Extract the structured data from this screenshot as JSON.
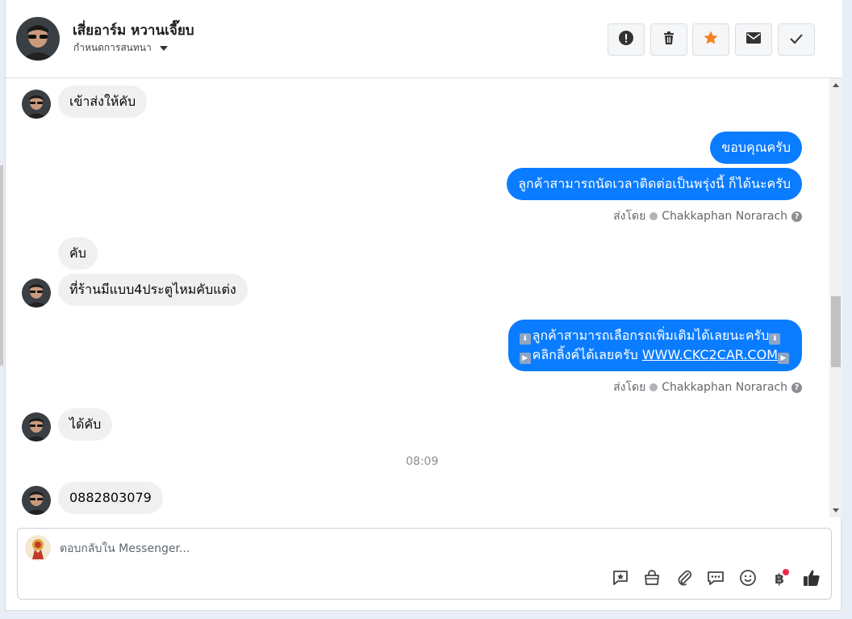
{
  "header": {
    "contact_name": "เสี่ยอาร์ม หวานเจี๊ยบ",
    "conversation_settings": "กำหนดการสนทนา"
  },
  "messages": {
    "m1": "เข้าส่งให้คับ",
    "m2": "ขอบคุณครับ",
    "m3": "ลูกค้าสามารถนัดเวลาติดต่อเป็นพรุ่งนี้ ก็ได้นะครับ",
    "sent_by_label": "ส่งโดย",
    "agent_name": "Chakkaphan Norarach",
    "m4": "คับ",
    "m5": "ที่ร้านมีแบบ4ประตูไหมคับแต่ง",
    "m6_line1": "ลูกค้าสามารถเลือกรถเพิ่มเติมได้เลยนะครับ",
    "m6_line2_text": "คลิกลิ้งค์ได้เลยครับ",
    "m6_link": "WWW.CKC2CAR.COM",
    "m7": "ได้คับ",
    "timestamp": "08:09",
    "m8": "0882803079"
  },
  "composer": {
    "placeholder": "ตอบกลับใน Messenger..."
  },
  "icons": {
    "header_buttons": [
      "alert-icon",
      "trash-icon",
      "star-icon",
      "mail-icon",
      "check-icon"
    ],
    "toolbar": [
      "saved-reply-icon",
      "shop-bag-icon",
      "attachment-icon",
      "chat-bubbles-icon",
      "emoji-icon",
      "baht-payment-icon",
      "like-icon"
    ]
  },
  "colors": {
    "outgoing_bubble": "#0a7cff",
    "incoming_bubble": "#f0f0f0",
    "star": "#f5831f",
    "notification_dot": "#f02849"
  }
}
